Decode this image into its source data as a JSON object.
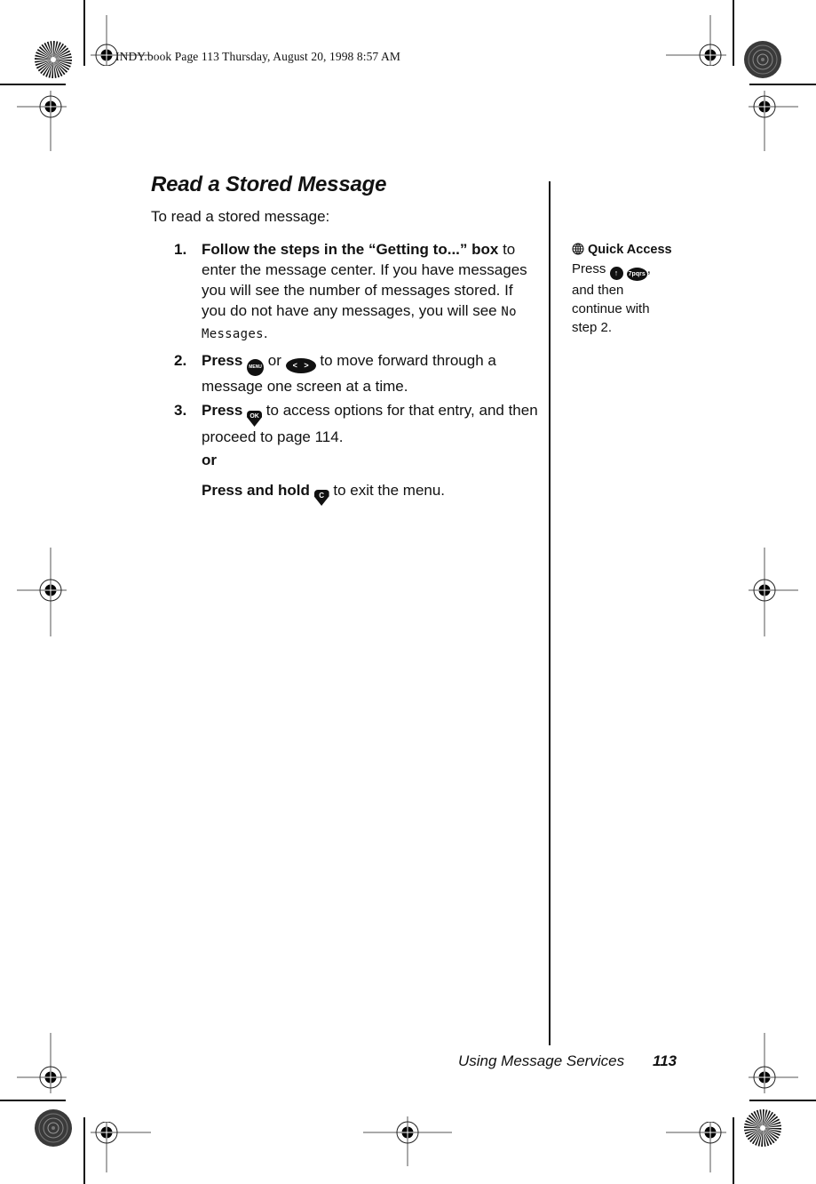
{
  "print_slug": "INDY.book  Page 113  Thursday, August 20, 1998  8:57 AM",
  "page": {
    "title": "Read a Stored Message",
    "intro": "To read a stored message:",
    "steps": [
      {
        "number": "1.",
        "bold": "Follow the steps in the “Getting to...” box",
        "text": "to enter the message center. If you have messages you will see the number of messages stored. If you do not have any messages, you will see",
        "lcd": "No Messages",
        "tail": "."
      },
      {
        "number": "2.",
        "bold": "Press",
        "key1": {
          "icon": "menu-key-icon",
          "label": "MENU"
        },
        "or": "or",
        "key2": {
          "icon": "scroll-key-icon",
          "label_left": "<",
          "label_right": ">"
        },
        "text": "to move forward through a message one screen at a time."
      },
      {
        "number": "3.",
        "bold": "Press",
        "key": {
          "icon": "ok-key-icon",
          "label": "OK"
        },
        "text": "to access options for that entry, and then proceed to page 114."
      }
    ],
    "or_label": "or",
    "alt_step": {
      "bold": "Press and hold",
      "key": {
        "icon": "clear-key-icon",
        "label": "C"
      },
      "text": "to exit the menu."
    }
  },
  "sidebar": {
    "icon": "globe-icon",
    "heading": "Quick Access",
    "press": "Press",
    "key1": {
      "icon": "up-arrow-key-icon",
      "label": "↑"
    },
    "key2": {
      "icon": "seven-key-icon",
      "label": "7pqrs"
    },
    "comma": ",",
    "lines": [
      "and then",
      "continue with",
      "step 2."
    ]
  },
  "footer": {
    "section": "Using Message Services",
    "page_number": "113"
  }
}
